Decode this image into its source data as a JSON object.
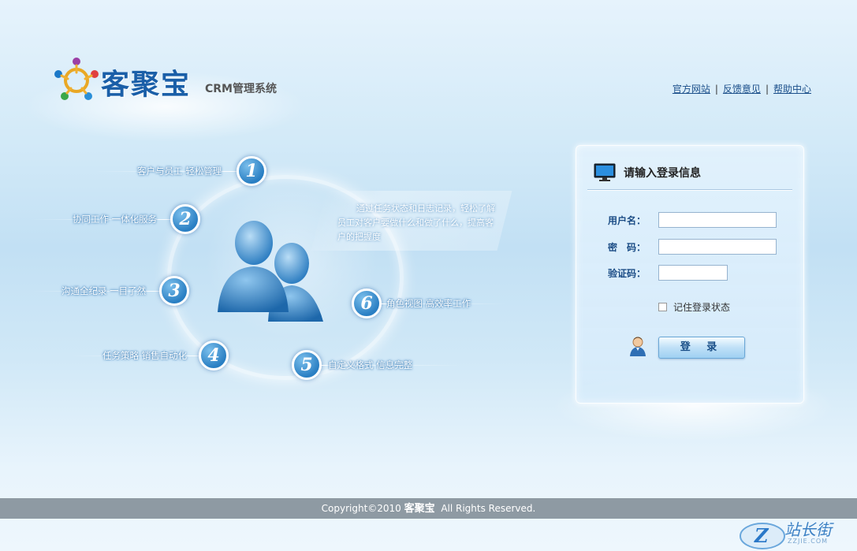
{
  "brand": {
    "name": "客聚宝",
    "subtitle": "CRM管理系统"
  },
  "top_links": [
    {
      "label": "官方网站"
    },
    {
      "label": "反馈意见"
    },
    {
      "label": "帮助中心"
    }
  ],
  "top_links_separator": "|",
  "features": [
    {
      "number": "1",
      "text": "客户与员工 轻松管理"
    },
    {
      "number": "2",
      "text": "协同工作 一体化服务"
    },
    {
      "number": "3",
      "text": "沟通全纪录 一目了然"
    },
    {
      "number": "4",
      "text": "任务策略 销售自动化"
    },
    {
      "number": "5",
      "text": "自定义格式 信息完整"
    },
    {
      "number": "6",
      "text": "角色视图 高效率工作"
    }
  ],
  "quote": "通过任务状态和日志记录，轻松了解员工对客户要做什么和做了什么，提高客户的把握度",
  "login": {
    "title": "请输入登录信息",
    "username_label": "用户名：",
    "password_label": "密　码：",
    "captcha_label": "验证码：",
    "username_value": "",
    "password_value": "",
    "captcha_value": "",
    "remember_label": "记住登录状态",
    "remember_checked": false,
    "submit_label": "登 录"
  },
  "footer": {
    "prefix": "Copyright©2010",
    "brand": "客聚宝",
    "suffix": "All Rights Reserved."
  },
  "watermark": {
    "text": "站长街",
    "sub": "ZZJIE.COM"
  },
  "colors": {
    "brand_blue": "#1a5fa8",
    "footer_bg": "#8e9aa3",
    "feature_badge": "#2a7fc3"
  }
}
